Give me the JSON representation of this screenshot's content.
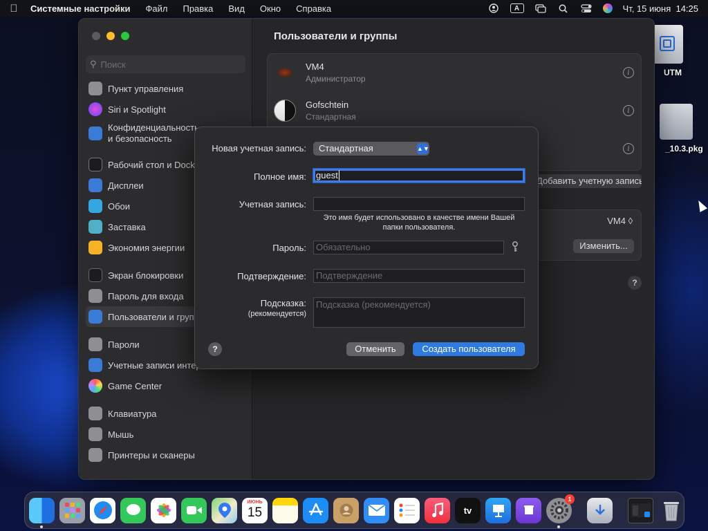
{
  "menubar": {
    "app_name": "Системные настройки",
    "items": [
      "Файл",
      "Правка",
      "Вид",
      "Окно",
      "Справка"
    ],
    "input_source": "A",
    "clock": "Чт, 15 июня  14:25"
  },
  "desktop": {
    "icons": [
      {
        "label": "UTM"
      },
      {
        "label": "_10.3.pkg"
      }
    ]
  },
  "sidebar": {
    "search_placeholder": "Поиск",
    "items": [
      {
        "label": "Пункт управления",
        "color": "#8e8e93"
      },
      {
        "label": "Siri и Spotlight",
        "color": "#b04fd6"
      },
      {
        "label": "Конфиденциальность и безопасность",
        "color": "#3a7bd5"
      },
      {
        "label": "Рабочий стол и Dock",
        "color": "#2c2c2e"
      },
      {
        "label": "Дисплеи",
        "color": "#3a7bd5"
      },
      {
        "label": "Обои",
        "color": "#35a7e0"
      },
      {
        "label": "Заставка",
        "color": "#4fb0c6"
      },
      {
        "label": "Экономия энергии",
        "color": "#f5b428"
      },
      {
        "label": "Экран блокировки",
        "color": "#2c2c2e"
      },
      {
        "label": "Пароль для входа",
        "color": "#8e8e93"
      },
      {
        "label": "Пользователи и группы",
        "color": "#3a7bd5"
      },
      {
        "label": "Пароли",
        "color": "#8e8e93"
      },
      {
        "label": "Учетные записи интернета",
        "color": "#3a7bd5"
      },
      {
        "label": "Game Center",
        "color": "#e0e0e0"
      },
      {
        "label": "Клавиатура",
        "color": "#8e8e93"
      },
      {
        "label": "Мышь",
        "color": "#8e8e93"
      },
      {
        "label": "Принтеры и сканеры",
        "color": "#8e8e93"
      }
    ]
  },
  "main": {
    "title": "Пользователи и группы",
    "users": [
      {
        "name": "VM4",
        "role": "Администратор"
      },
      {
        "name": "Gofschtein",
        "role": "Стандартная"
      }
    ],
    "add_account_label": "Добавить учетную запись...",
    "autologin_value": "VM4 ◊",
    "change_label": "Изменить..."
  },
  "dialog": {
    "account_type_label": "Новая учетная запись:",
    "account_type_value": "Стандартная",
    "full_name_label": "Полное имя:",
    "full_name_value": "guest",
    "account_name_label": "Учетная запись:",
    "account_name_value": "",
    "account_hint": "Это имя будет использовано в качестве имени Вашей папки пользователя.",
    "password_label": "Пароль:",
    "password_placeholder": "Обязательно",
    "verify_label": "Подтверждение:",
    "verify_placeholder": "Подтверждение",
    "hint_label": "Подсказка:",
    "hint_sublabel": "(рекомендуется)",
    "hint_placeholder": "Подсказка (рекомендуется)",
    "cancel_label": "Отменить",
    "create_label": "Создать пользователя",
    "help_label": "?"
  },
  "dock": {
    "calendar_month": "ИЮНЬ",
    "calendar_day": "15",
    "tv_label": "tv",
    "settings_badge": "1"
  }
}
